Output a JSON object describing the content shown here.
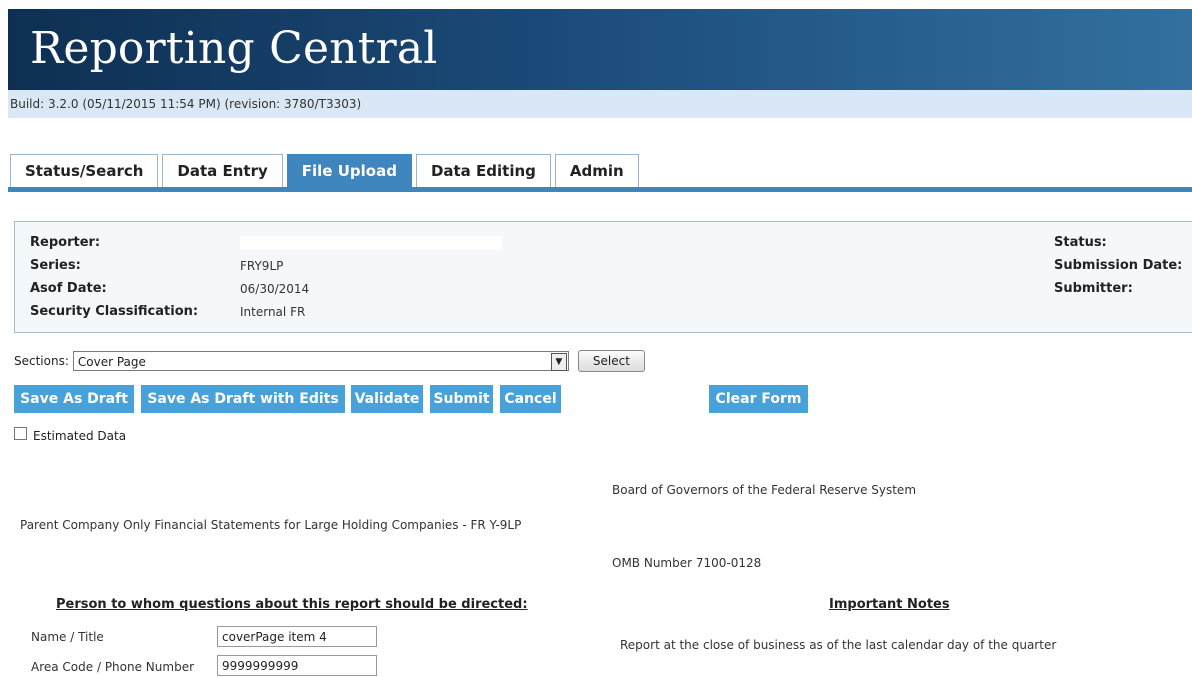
{
  "app": {
    "title": "Reporting Central",
    "build": "Build: 3.2.0 (05/11/2015 11:54 PM) (revision: 3780/T3303)"
  },
  "tabs": [
    {
      "label": "Status/Search",
      "active": false
    },
    {
      "label": "Data Entry",
      "active": false
    },
    {
      "label": "File Upload",
      "active": true
    },
    {
      "label": "Data Editing",
      "active": false
    },
    {
      "label": "Admin",
      "active": false
    }
  ],
  "info": {
    "reporter_label": "Reporter:",
    "series_label": "Series:",
    "series_value": "FRY9LP",
    "asof_label": "Asof Date:",
    "asof_value": "06/30/2014",
    "security_label": "Security Classification:",
    "security_value": "Internal FR",
    "status_label": "Status:",
    "submission_date_label": "Submission Date:",
    "submitter_label": "Submitter:"
  },
  "sections": {
    "label": "Sections:",
    "selected": "Cover Page",
    "select_button": "Select"
  },
  "actions": {
    "save_draft": "Save As Draft",
    "save_draft_edits": "Save As Draft with Edits",
    "validate": "Validate",
    "submit": "Submit",
    "cancel": "Cancel",
    "clear_form": "Clear Form"
  },
  "estimated": {
    "label": "Estimated Data",
    "checked": false
  },
  "form": {
    "board": "Board of Governors of the Federal Reserve System",
    "report_title": "Parent Company Only Financial Statements for Large Holding Companies - FR Y-9LP",
    "omb": "OMB Number 7100-0128",
    "contact_heading": "Person to whom questions about this report should be directed:",
    "name_label": "Name / Title",
    "name_value": "coverPage item 4",
    "phone_label": "Area Code / Phone Number",
    "phone_value": "9999999999",
    "notes_heading": "Important Notes",
    "note_1": "Report at the close of business as of the last calendar day of the quarter"
  },
  "colors": {
    "header_dark": "#0e2f52",
    "header_light": "#33709f",
    "accent": "#3f86bf",
    "button": "#48a2d9",
    "build_bar": "#dae8f6"
  }
}
